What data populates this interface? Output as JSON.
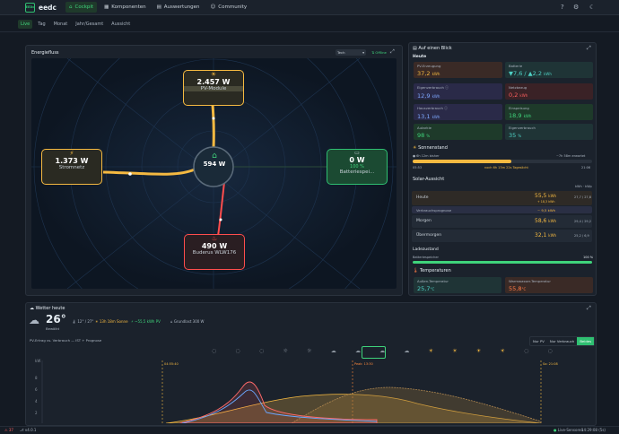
{
  "app": {
    "logo": "EEDc",
    "title": "eedc"
  },
  "nav": [
    {
      "label": "Cockpit",
      "icon": "house-icon",
      "active": true
    },
    {
      "label": "Komponenten",
      "icon": "grid-icon",
      "active": false
    },
    {
      "label": "Auswertungen",
      "icon": "chart-icon",
      "active": false
    },
    {
      "label": "Community",
      "icon": "users-icon",
      "active": false
    }
  ],
  "tabs": [
    {
      "label": "Live",
      "active": true
    },
    {
      "label": "Tag"
    },
    {
      "label": "Monat"
    },
    {
      "label": "Jahr/Gesamt"
    },
    {
      "label": "Aussicht"
    }
  ],
  "energiefluss": {
    "title": "Energiefluss",
    "select": "Tech",
    "status": "Offline",
    "pv": {
      "value": "2.457 W",
      "label": "PV-Module"
    },
    "grid": {
      "value": "1.373 W",
      "label": "Stromnetz"
    },
    "house": {
      "value": "594 W"
    },
    "battery": {
      "value": "0 W",
      "pct": "100 %",
      "label": "Batteriespei..."
    },
    "heatpump": {
      "value": "490 W",
      "label": "Buderus WLW176"
    }
  },
  "glance": {
    "title": "Auf einen Blick",
    "heute": "Heute",
    "cards": [
      {
        "label": "PV-Erzeugung",
        "value": "37,2",
        "unit": "kWh",
        "color": "#f5b941"
      },
      {
        "label": "Batterie",
        "value": "▼7,6 / ▲2,2",
        "unit": "kWh",
        "color": "#4fd1c5"
      },
      {
        "label": "Eigenverbrauch ⓘ",
        "value": "12,9",
        "unit": "kWh",
        "color": "#7ea8ff"
      },
      {
        "label": "Netzbezug",
        "value": "0,2",
        "unit": "kWh",
        "color": "#ff5f5f"
      },
      {
        "label": "Hausverbrauch ⓘ",
        "value": "13,1",
        "unit": "kWh",
        "color": "#7ea8ff"
      },
      {
        "label": "Einspeisung",
        "value": "18,9",
        "unit": "kWh",
        "color": "#3fd37b"
      },
      {
        "label": "Autarkie",
        "value": "98",
        "unit": "%",
        "color": "#3fd37b"
      },
      {
        "label": "Eigenverbrauch",
        "value": "35",
        "unit": "%",
        "color": "#4fd1c5"
      }
    ]
  },
  "sonnenstand": {
    "title": "Sonnenstand",
    "left": "6h 12m bisher",
    "right": "~7h 58m erwartet",
    "t_start": "05:53",
    "center": "noch 6h 13m 22s Tageslicht",
    "t_end": "21:06"
  },
  "solar": {
    "title": "Solar-Aussicht",
    "header": "kWh · kWp",
    "rows": [
      {
        "label": "Heute",
        "value": "55,5",
        "unit": "kWh",
        "sub": "+ 18,3 kWh",
        "right": "27,7 / 27,8"
      },
      {
        "label": "Verbrauchsprognose",
        "value": "~ 9,5 kWh"
      },
      {
        "label": "Morgen",
        "value": "58,6",
        "unit": "kWh",
        "right": "29,4 / 29,2"
      },
      {
        "label": "Übermorgen",
        "value": "32,1",
        "unit": "kWh",
        "right": "25,2 / 6,9"
      }
    ]
  },
  "ladezustand": {
    "title": "Ladezustand",
    "label": "Batteriespeicher",
    "value": "100 %"
  },
  "temperaturen": {
    "title": "Temperaturen",
    "items": [
      {
        "label": "Außen-Temperatur",
        "value": "25,7",
        "unit": "°C",
        "color": "#4fd1c5"
      },
      {
        "label": "Warmwasser-Temperatur",
        "value": "55,8",
        "unit": "°C",
        "color": "#ff7a45"
      }
    ]
  },
  "wetter": {
    "title": "Wetter heute",
    "temp": "26°",
    "desc": "Bewölkt",
    "range": "12° / 27°",
    "sun": "13h 18m Sonne",
    "pv": "~55,5 kWh PV",
    "grund": "Grundlast 300 W",
    "chart_label": "PV-Ertrag vs. Verbrauch — IST + Prognose",
    "toggles": [
      "Nur PV",
      "Nur Verbrauch",
      "Beides"
    ],
    "markers": [
      "04:55:40",
      "Peak: 13:30",
      "So: 21:08"
    ]
  },
  "chart_data": {
    "type": "area",
    "y_ticks": [
      "8",
      "6",
      "4",
      "2"
    ],
    "ylabel": "kW"
  },
  "statusbar": {
    "left": "37",
    "version": "v4.0.1",
    "right_label": "Live-Sensoren",
    "time": "14:29:08 (5s)"
  }
}
